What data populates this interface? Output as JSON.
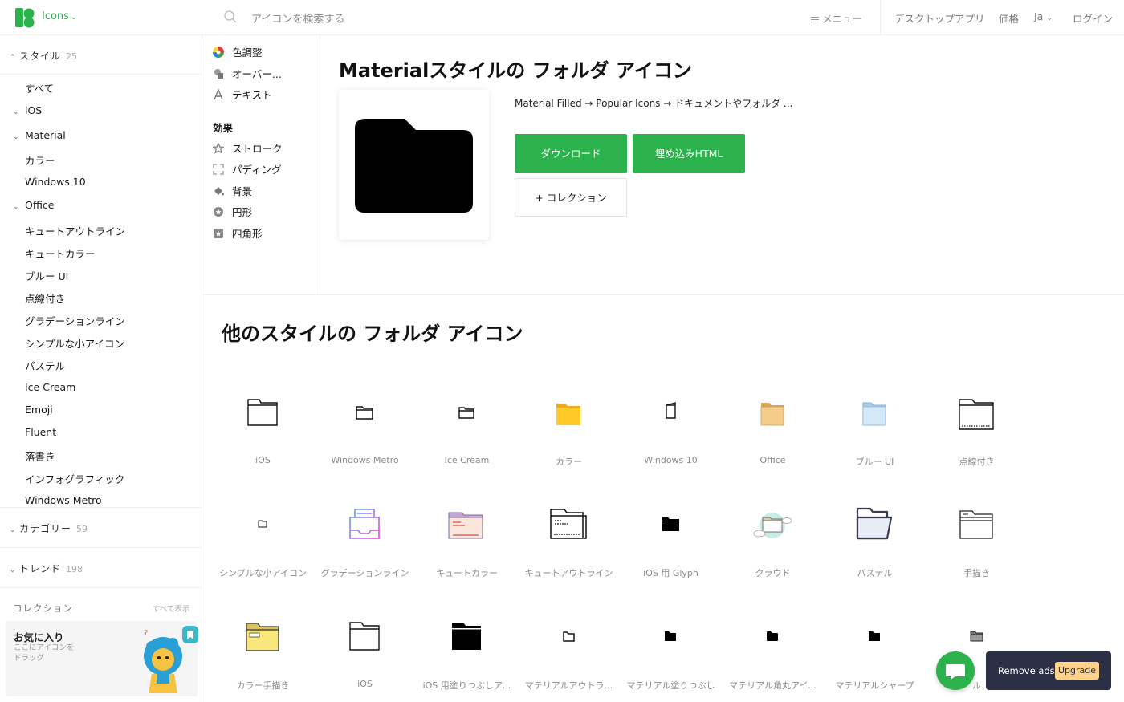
{
  "header": {
    "brand": "Icons",
    "search_placeholder": "アイコンを検索する",
    "menu_label": "メニュー",
    "desktop_app": "デスクトップアプリ",
    "pricing": "価格",
    "language": "Ja",
    "login": "ログイン"
  },
  "sidebar": {
    "style_head": "スタイル",
    "style_count": "25",
    "all": "すべて",
    "groups": {
      "ios": "iOS",
      "material": "Material",
      "office": "Office"
    },
    "material_items": [
      "カラー",
      "Windows 10"
    ],
    "office_items": [
      "キュートアウトライン",
      "キュートカラー",
      "ブルー UI",
      "点線付き",
      "グラデーションライン",
      "シンプルな小アイコン",
      "パステル",
      "Ice Cream",
      "Emoji",
      "Fluent",
      "落書き",
      "インフォグラフィック",
      "Windows Metro"
    ],
    "category_head": "カテゴリー",
    "category_count": "59",
    "trend_head": "トレンド",
    "trend_count": "198",
    "collection_head": "コレクション",
    "collection_all": "すべて表示",
    "fav_title": "お気に入り",
    "fav_sub": "ここにアイコンをドラッグ"
  },
  "options": {
    "color_adjust": "色調整",
    "overlay": "オーバー...",
    "text": "テキスト",
    "effects_title": "効果",
    "stroke": "ストローク",
    "padding": "パディング",
    "background": "背景",
    "circle": "円形",
    "square": "四角形"
  },
  "main": {
    "title": "Materialスタイルの フォルダ アイコン",
    "breadcrumb": "Material Filled → Popular Icons → ドキュメントやフォルダ ...",
    "download": "ダウンロード",
    "embed": "埋め込みHTML",
    "add_collection": "+ コレクション"
  },
  "other": {
    "title": "他のスタイルの フォルダ アイコン",
    "items": [
      {
        "label": "iOS",
        "icon": "folder-ios-outline-icon"
      },
      {
        "label": "Windows Metro",
        "icon": "folder-metro-icon"
      },
      {
        "label": "Ice Cream",
        "icon": "folder-ice-cream-icon"
      },
      {
        "label": "カラー",
        "icon": "folder-yellow-color-icon"
      },
      {
        "label": "Windows 10",
        "icon": "folder-win10-icon"
      },
      {
        "label": "Office",
        "icon": "folder-office-icon"
      },
      {
        "label": "ブルー UI",
        "icon": "folder-blue-ui-icon"
      },
      {
        "label": "点線付き",
        "icon": "folder-dotted-icon"
      },
      {
        "label": "シンプルな小アイコン",
        "icon": "folder-small-icon"
      },
      {
        "label": "グラデーションライン",
        "icon": "folder-gradient-tray-icon"
      },
      {
        "label": "キュートカラー",
        "icon": "folder-cute-color-icon"
      },
      {
        "label": "キュートアウトライン",
        "icon": "folder-cute-outline-icon"
      },
      {
        "label": "iOS 用 Glyph",
        "icon": "folder-ios-glyph-icon"
      },
      {
        "label": "クラウド",
        "icon": "folder-cloud-icon"
      },
      {
        "label": "パステル",
        "icon": "folder-pastel-icon"
      },
      {
        "label": "手描き",
        "icon": "folder-hand-drawn-icon"
      },
      {
        "label": "カラー手描き",
        "icon": "folder-color-hand-drawn-icon"
      },
      {
        "label": "iOS",
        "icon": "folder-ios-large-icon"
      },
      {
        "label": "iOS 用塗りつぶしア...",
        "icon": "folder-ios-filled-icon"
      },
      {
        "label": "マテリアルアウトラ...",
        "icon": "folder-material-outline-icon"
      },
      {
        "label": "マテリアル塗りつぶし",
        "icon": "folder-material-filled-icon"
      },
      {
        "label": "マテリアル角丸アイ...",
        "icon": "folder-material-rounded-icon"
      },
      {
        "label": "マテリアルシャープ",
        "icon": "folder-material-sharp-icon"
      },
      {
        "label": "ル",
        "icon": "folder-gray-icon"
      }
    ]
  },
  "ads": {
    "remove": "Remove ads",
    "upgrade": "Upgrade"
  }
}
